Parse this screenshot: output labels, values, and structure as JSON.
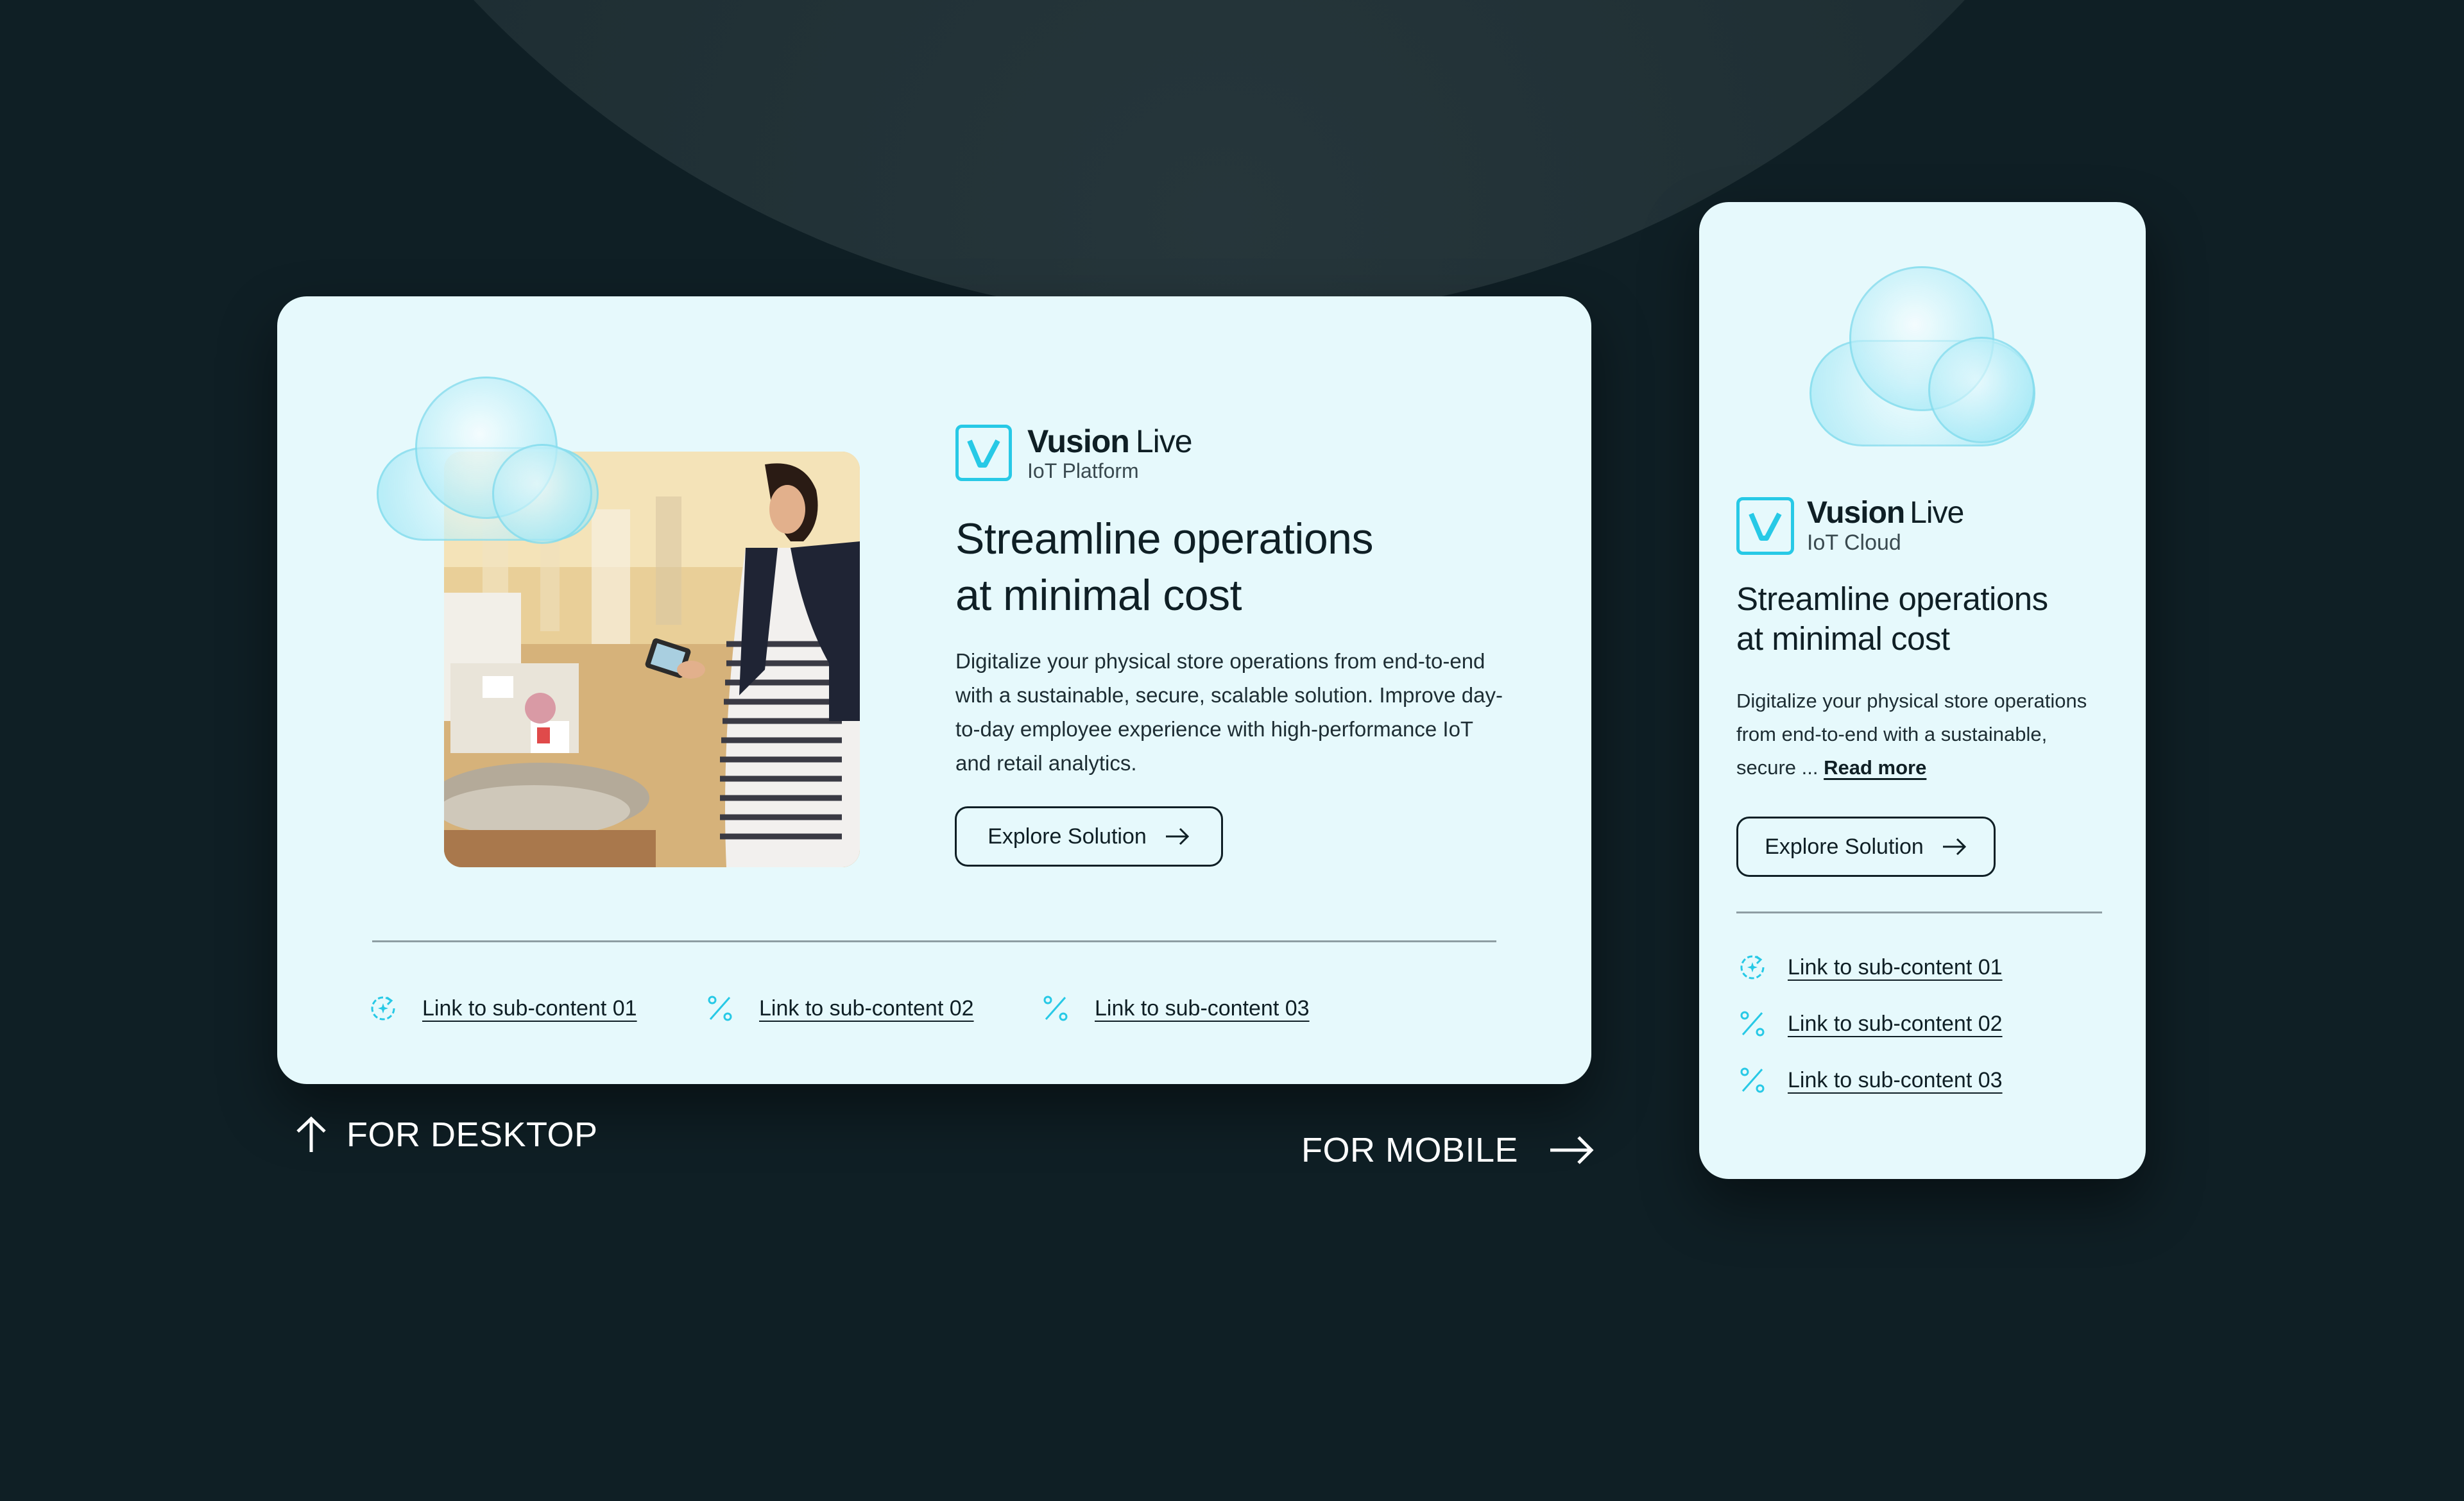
{
  "colors": {
    "background": "#0f1f25",
    "card": "#e6f9fc",
    "accent": "#27c9e6",
    "text": "#0f1f25"
  },
  "desktop": {
    "brand": {
      "name_bold": "Vusion",
      "name_light": "Live",
      "subtitle": "IoT Platform",
      "icon": "vusion-logo-icon"
    },
    "heading": {
      "line1": "Streamline operations",
      "line2": "at minimal cost"
    },
    "body": "Digitalize your physical store operations from end-to-end with a sustainable, secure, scalable solution. Improve day-to-day employee experience with high-performance IoT and retail analytics.",
    "button": {
      "label": "Explore Solution",
      "icon": "arrow-right-icon"
    },
    "links": [
      {
        "label": "Link to sub-content 01",
        "icon": "refresh-sparkle-icon"
      },
      {
        "label": "Link to sub-content 02",
        "icon": "percent-icon"
      },
      {
        "label": "Link to sub-content 03",
        "icon": "percent-icon"
      }
    ]
  },
  "mobile": {
    "brand": {
      "name_bold": "Vusion",
      "name_light": "Live",
      "subtitle": "IoT Cloud",
      "icon": "vusion-logo-icon"
    },
    "heading": {
      "line1": "Streamline operations",
      "line2": "at minimal cost"
    },
    "body": "Digitalize your physical store operations from end-to-end with a sustainable, secure ...",
    "read_more": "Read more",
    "button": {
      "label": "Explore Solution",
      "icon": "arrow-right-icon"
    },
    "links": [
      {
        "label": "Link to sub-content 01",
        "icon": "refresh-sparkle-icon"
      },
      {
        "label": "Link to sub-content 02",
        "icon": "percent-icon"
      },
      {
        "label": "Link to sub-content 03",
        "icon": "percent-icon"
      }
    ]
  },
  "captions": {
    "desktop": {
      "label": "FOR DESKTOP",
      "icon": "arrow-up-icon"
    },
    "mobile": {
      "label": "FOR MOBILE",
      "icon": "arrow-right-icon"
    }
  }
}
